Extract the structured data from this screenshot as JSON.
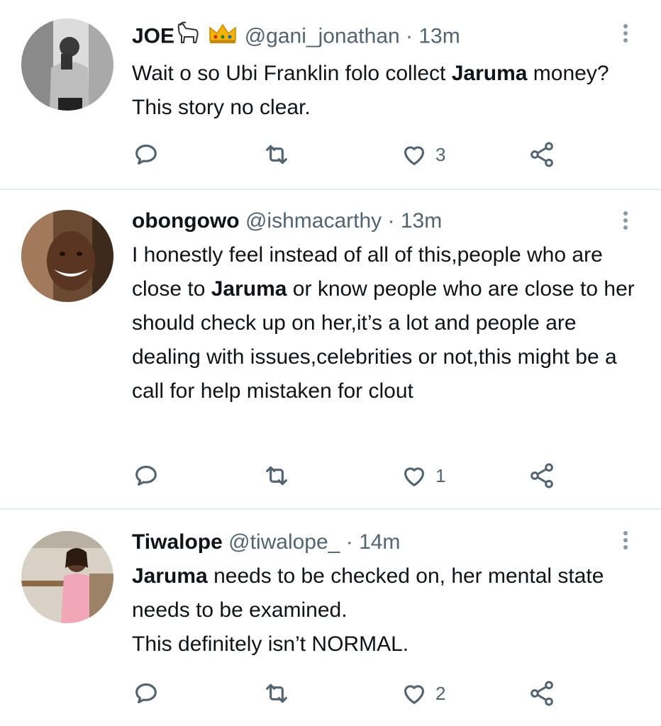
{
  "tweets": [
    {
      "name": "JOE",
      "name_emojis": [
        "goat-emoji",
        "crown-emoji"
      ],
      "handle": "@gani_jonathan",
      "separator": "·",
      "time": "13m",
      "text_parts": [
        {
          "text": "Wait o so Ubi Franklin folo collect "
        },
        {
          "text": "Jaruma",
          "bold": true
        },
        {
          "text": " money? This story no clear."
        }
      ],
      "likes": "3"
    },
    {
      "name": "obongowo",
      "handle": "@ishmacarthy",
      "separator": "·",
      "time": "13m",
      "text_parts": [
        {
          "text": "I honestly feel instead of all of this,people who are close to "
        },
        {
          "text": "Jaruma",
          "bold": true
        },
        {
          "text": " or know people who are close to her should check up on her,it’s a lot and people are dealing with issues,celebrities or not,this might be a call for help mistaken for clout"
        }
      ],
      "likes": "1"
    },
    {
      "name": "Tiwalope",
      "handle": "@tiwalope_",
      "separator": "·",
      "time": "14m",
      "text_parts": [
        {
          "text": "Jaruma",
          "bold": true
        },
        {
          "text": " needs to be checked on, her mental state needs to be examined."
        },
        {
          "break": true
        },
        {
          "text": "This definitely isn’t NORMAL."
        }
      ],
      "likes": "2"
    }
  ],
  "icons": {
    "reply": "reply-icon",
    "retweet": "retweet-icon",
    "like": "heart-icon",
    "share": "share-icon",
    "more": "more-vertical-icon"
  },
  "colors": {
    "text": "#0f1419",
    "secondary": "#536471",
    "divider": "#e6ecf0",
    "icon": "#536471"
  }
}
